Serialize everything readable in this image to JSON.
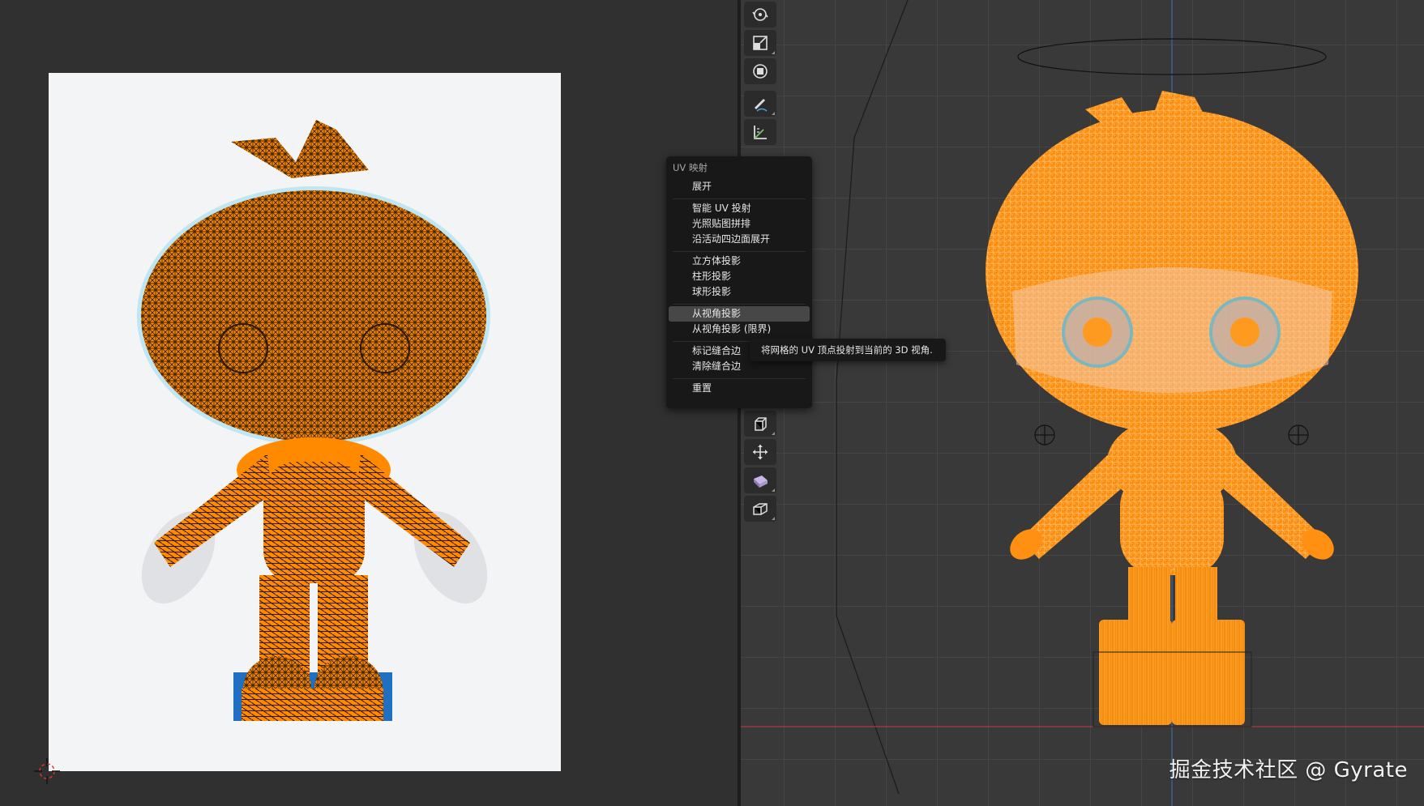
{
  "uv_menu": {
    "title": "UV 映射",
    "items": [
      {
        "label": "展开"
      },
      {
        "label": "智能 UV 投射"
      },
      {
        "label": "光照贴图拼排"
      },
      {
        "label": "沿活动四边面展开"
      },
      {
        "label": "立方体投影"
      },
      {
        "label": "柱形投影"
      },
      {
        "label": "球形投影"
      },
      {
        "label": "从视角投影",
        "highlighted": true
      },
      {
        "label": "从视角投影 (限界)"
      },
      {
        "label": "标记缝合边"
      },
      {
        "label": "清除缝合边"
      },
      {
        "label": "重置"
      }
    ]
  },
  "tooltip": {
    "text": "将网格的 UV 顶点投射到当前的 3D 视角."
  },
  "watermark": {
    "text": "掘金技术社区 @ Gyrate"
  },
  "toolbar": {
    "tools": [
      "rotate-tool-icon",
      "scale-tool-icon",
      "transform-tool-icon",
      "annotate-tool-icon",
      "measure-tool-icon",
      "extrude-tool-icon",
      "move-gizmo-icon",
      "shear-tool-icon",
      "cube-add-icon"
    ]
  },
  "colors": {
    "mesh_orange": "#ff8a00",
    "uv_background": "#f3f4f6",
    "viewport_bg": "#393939",
    "menu_bg": "#181818"
  }
}
